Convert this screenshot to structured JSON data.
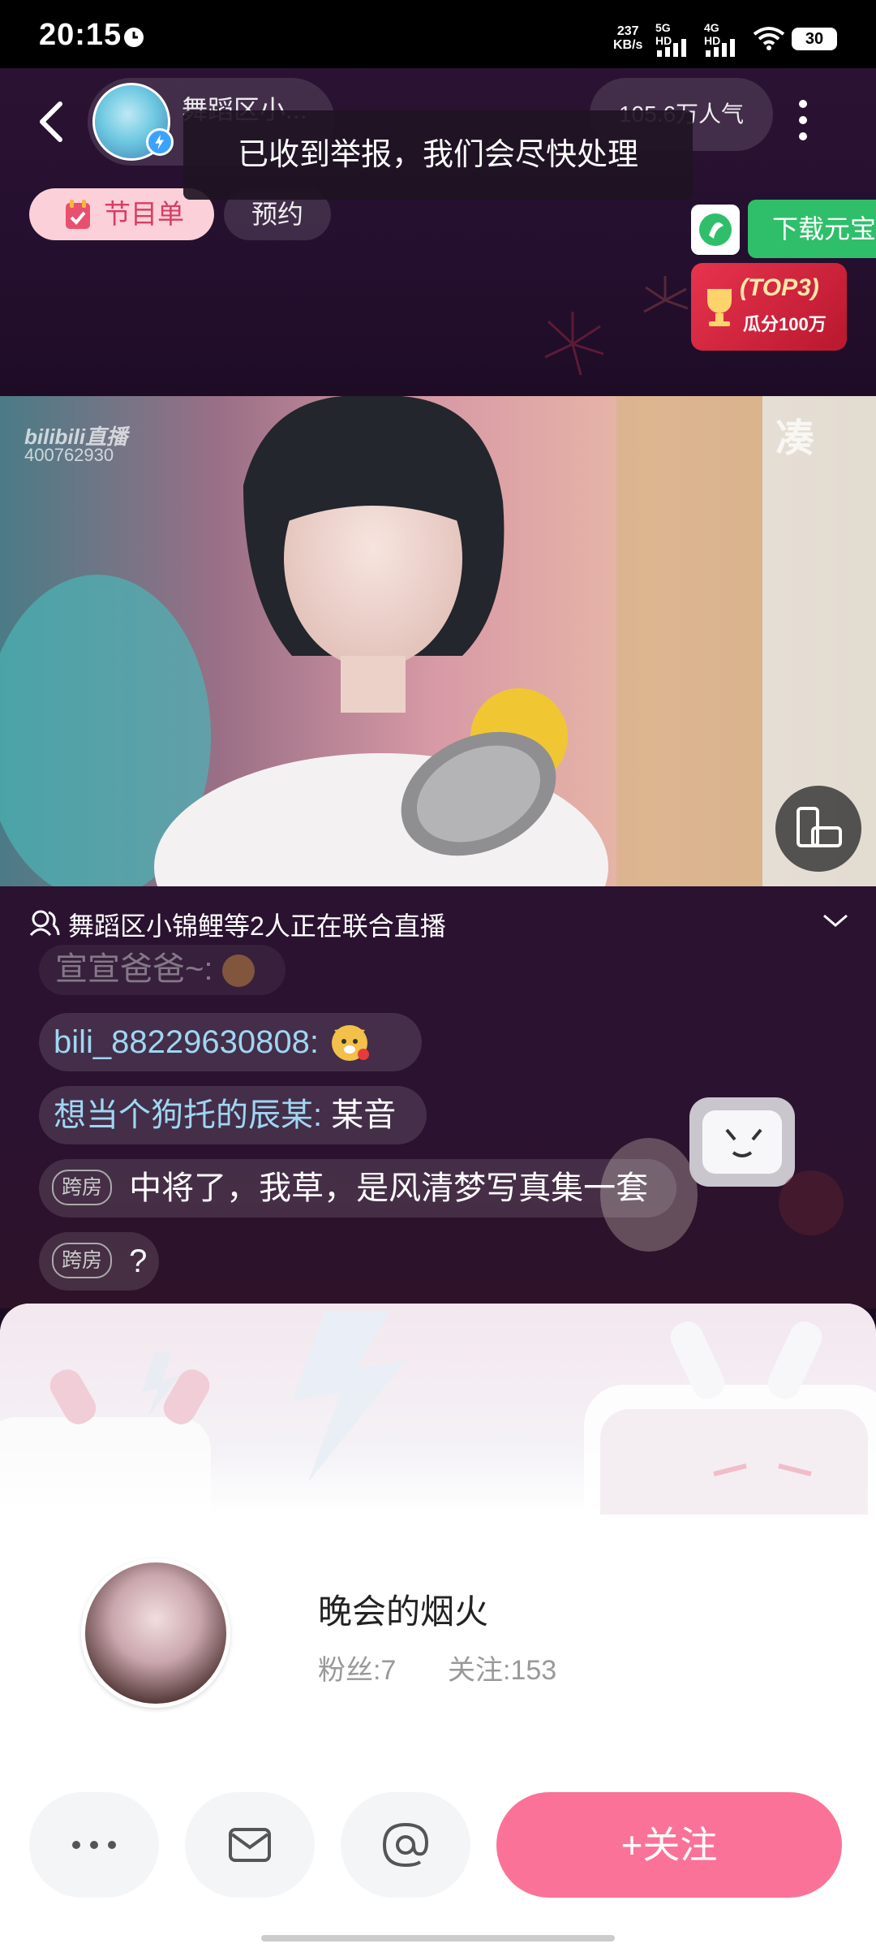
{
  "status_bar": {
    "time": "20:15",
    "speed_value": "237",
    "speed_unit": "KB/s",
    "net1": "5G HD",
    "net2": "4G HD",
    "battery": "30"
  },
  "header": {
    "anchor_name": "舞蹈区小...",
    "popularity": "105.6万人气",
    "toast": "已收到举报，我们会尽快处理",
    "program_label": "节目单",
    "reserve_label": "预约",
    "download_label": "下载元宝",
    "promo_title": "(TOP3)",
    "promo_subtitle": "瓜分100万"
  },
  "video": {
    "watermark": "bilibili直播",
    "room_id": "400762930",
    "corner_char": "凑"
  },
  "joint_live": {
    "text": "舞蹈区小锦鲤等2人正在联合直播"
  },
  "chat": {
    "partial_name": "宣宣爸爸~:",
    "messages": [
      {
        "user": "bili_88229630808:",
        "text": ""
      },
      {
        "user": "想当个狗托的辰某:",
        "text": "某音"
      },
      {
        "tag": "跨房",
        "text": "中将了，我草，是风清梦写真集一套"
      },
      {
        "tag": "跨房",
        "text": "?"
      }
    ]
  },
  "profile": {
    "name": "晚会的烟火",
    "fans": "粉丝:7",
    "following": "关注:153",
    "follow_button": "+关注"
  },
  "colors": {
    "accent_pink": "#fb7299",
    "download_green": "#2fbf6a",
    "username_blue": "#9fd6f2"
  }
}
